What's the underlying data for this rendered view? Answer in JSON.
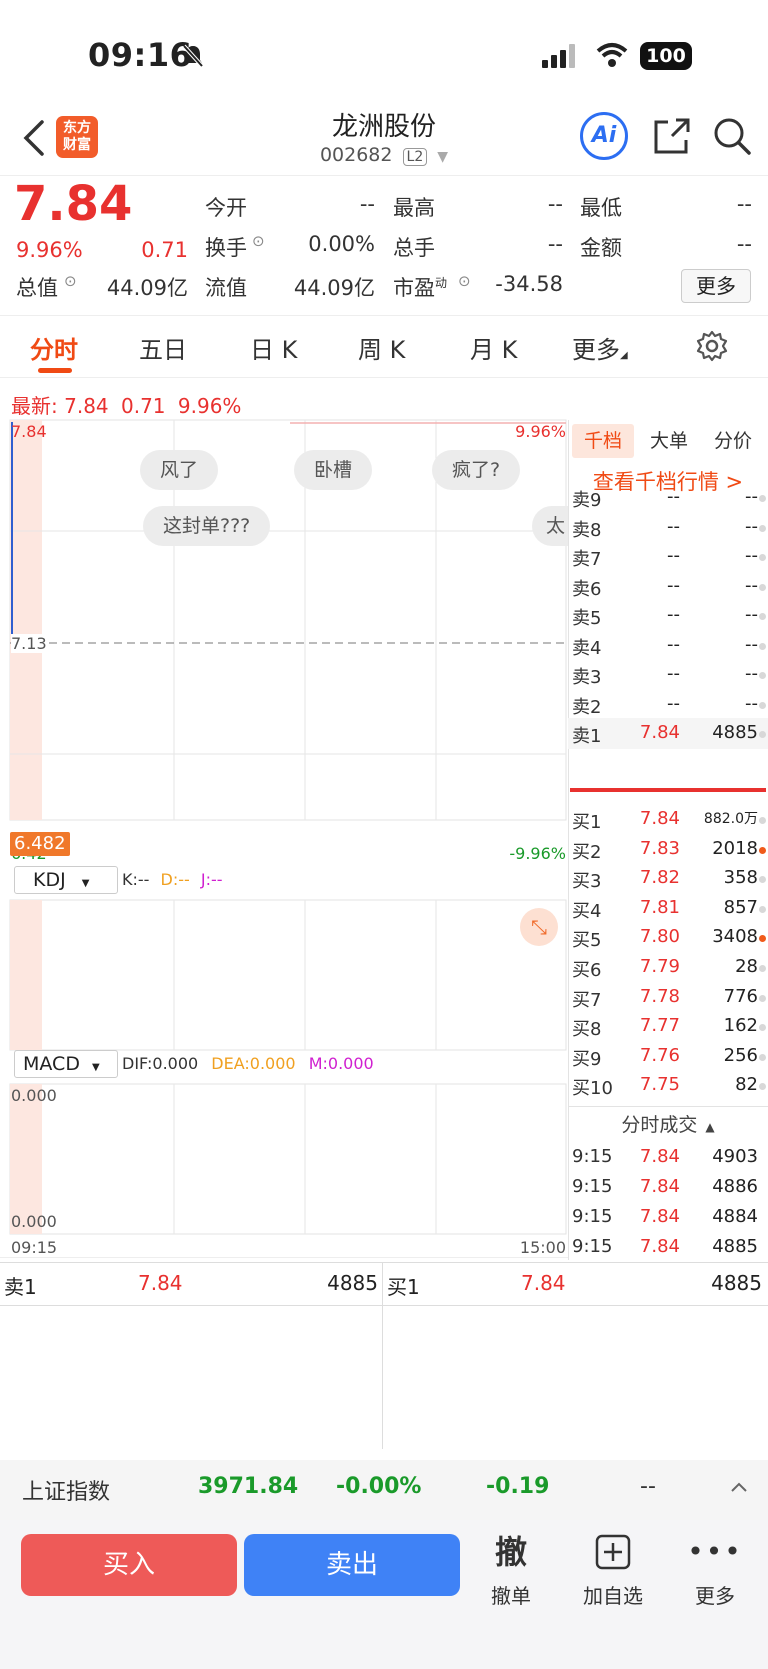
{
  "status": {
    "time": "09:16",
    "battery": "100"
  },
  "header": {
    "logo_line1": "东方",
    "logo_line2": "财富",
    "title": "龙洲股份",
    "code": "002682",
    "level": "L2",
    "ai_label": "Ai"
  },
  "quote": {
    "price": "7.84",
    "change_pct": "9.96%",
    "change": "0.71",
    "open_label": "今开",
    "open_val": "--",
    "high_label": "最高",
    "high_val": "--",
    "low_label": "最低",
    "low_val": "--",
    "turnover_label": "换手",
    "turnover_val": "0.00%",
    "volume_label": "总手",
    "volume_val": "--",
    "amount_label": "金额",
    "amount_val": "--",
    "mcap_label": "总值",
    "mcap_val": "44.09亿",
    "float_label": "流值",
    "float_val": "44.09亿",
    "pe_label": "市盈",
    "pe_sup": "动",
    "pe_val": "-34.58",
    "more_button": "更多"
  },
  "tabs": [
    "分时",
    "五日",
    "日 K",
    "周 K",
    "月 K",
    "更多"
  ],
  "latest": {
    "label": "最新:",
    "price": "7.84",
    "change": "0.71",
    "pct": "9.96%"
  },
  "chart": {
    "top_price": "7.84",
    "top_pct": "9.96%",
    "mid_price": "7.13",
    "bottom_price": "6.42",
    "bottom_pct": "-9.96%",
    "cursor_price": "6.482",
    "start_time": "09:15",
    "end_time": "15:00",
    "bubbles": [
      "风了",
      "卧槽",
      "疯了?",
      "这封单???",
      "太"
    ],
    "kdj": {
      "name": "KDJ",
      "k": "K:--",
      "d": "D:--",
      "j": "J:--"
    },
    "macd": {
      "name": "MACD",
      "dif": "DIF:0.000",
      "dea": "DEA:0.000",
      "m": "M:0.000",
      "top": "0.000",
      "bottom": "0.000"
    },
    "colors": {
      "up": "#e8312f",
      "down": "#1a9a2a",
      "k_line": "#333333",
      "d_line": "#f0a020",
      "j_line": "#d020d0"
    }
  },
  "orderbook": {
    "tabs": [
      "千档",
      "大单",
      "分价"
    ],
    "link": "查看千档行情 >",
    "sells": [
      {
        "label": "卖9",
        "price": "--",
        "vol": "--"
      },
      {
        "label": "卖8",
        "price": "--",
        "vol": "--"
      },
      {
        "label": "卖7",
        "price": "--",
        "vol": "--"
      },
      {
        "label": "卖6",
        "price": "--",
        "vol": "--"
      },
      {
        "label": "卖5",
        "price": "--",
        "vol": "--"
      },
      {
        "label": "卖4",
        "price": "--",
        "vol": "--"
      },
      {
        "label": "卖3",
        "price": "--",
        "vol": "--"
      },
      {
        "label": "卖2",
        "price": "--",
        "vol": "--"
      },
      {
        "label": "卖1",
        "price": "7.84",
        "vol": "4885"
      }
    ],
    "buys": [
      {
        "label": "买1",
        "price": "7.84",
        "vol": "882.0万",
        "dot": "gray"
      },
      {
        "label": "买2",
        "price": "7.83",
        "vol": "2018",
        "dot": "orange"
      },
      {
        "label": "买3",
        "price": "7.82",
        "vol": "358",
        "dot": "gray"
      },
      {
        "label": "买4",
        "price": "7.81",
        "vol": "857",
        "dot": "gray"
      },
      {
        "label": "买5",
        "price": "7.80",
        "vol": "3408",
        "dot": "orange"
      },
      {
        "label": "买6",
        "price": "7.79",
        "vol": "28",
        "dot": "gray"
      },
      {
        "label": "买7",
        "price": "7.78",
        "vol": "776",
        "dot": "gray"
      },
      {
        "label": "买8",
        "price": "7.77",
        "vol": "162",
        "dot": "gray"
      },
      {
        "label": "买9",
        "price": "7.76",
        "vol": "256",
        "dot": "gray"
      },
      {
        "label": "买10",
        "price": "7.75",
        "vol": "82",
        "dot": "gray"
      }
    ],
    "ticks_title": "分时成交",
    "ticks": [
      {
        "time": "9:15",
        "price": "7.84",
        "vol": "4903"
      },
      {
        "time": "9:15",
        "price": "7.84",
        "vol": "4886"
      },
      {
        "time": "9:15",
        "price": "7.84",
        "vol": "4884"
      },
      {
        "time": "9:15",
        "price": "7.84",
        "vol": "4885"
      }
    ]
  },
  "bottom_quotes": {
    "left": {
      "label": "卖1",
      "price": "7.84",
      "vol": "4885"
    },
    "right": {
      "label": "买1",
      "price": "7.84",
      "vol": "4885"
    }
  },
  "index": {
    "name": "上证指数",
    "value": "3971.84",
    "pct": "-0.00%",
    "change": "-0.19",
    "extra": "--"
  },
  "actions": {
    "buy": "买入",
    "sell": "卖出",
    "cancel_icon_text": "撤",
    "cancel": "撤单",
    "watchlist": "加自选",
    "more": "更多"
  }
}
